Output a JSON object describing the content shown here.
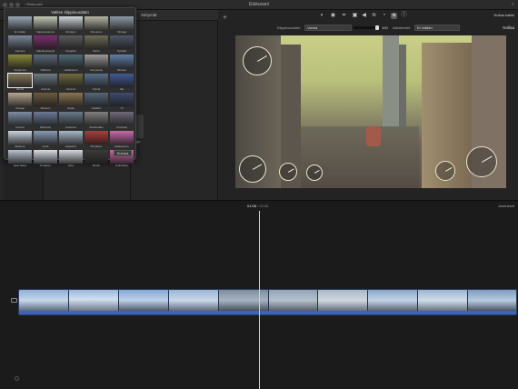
{
  "titlebar": {
    "title": "Elokuvani",
    "back_label": "Elokuvani",
    "share_label": ""
  },
  "left_panel": {
    "tab_label": "Siirtymät",
    "stub_label": "ge"
  },
  "toolbar": {
    "reset_all_label": "Nollaa kaikki",
    "icons": [
      "color-balance",
      "color-correction",
      "crop",
      "stabilization",
      "volume",
      "noise-reduction",
      "speed",
      "clip-filter",
      "info"
    ]
  },
  "options": {
    "clip_filter_label": "Klippisuodatin:",
    "clip_filter_value": "Vanha",
    "slider_value": "100",
    "audio_effects_label": "Ääniefektit:",
    "audio_effects_value": "Ei mitään",
    "reset_label": "Nollaa"
  },
  "timeline": {
    "current_time": "01:06",
    "total_time": "/ 02:56",
    "settings_label": "Asetukset"
  },
  "popup": {
    "title": "Valitse klippisuodatin",
    "cancel_label": "Kumoa",
    "filters": [
      {
        "name": "Ei mitään",
        "color": "#9aa7b5"
      },
      {
        "name": "Kaksoisvalotus",
        "color": "#c4c9b8"
      },
      {
        "name": "Röntgen",
        "color": "#d0d5d8"
      },
      {
        "name": "Romance",
        "color": "#b5b5a5"
      },
      {
        "name": "Vintage",
        "color": "#8f9aa5"
      },
      {
        "name": "Kamera",
        "color": "#7d8799"
      },
      {
        "name": "Kaleidoskooppi",
        "color": "#7a2e6e"
      },
      {
        "name": "Negatiivi",
        "color": "#5a5a5a"
      },
      {
        "name": "Retro",
        "color": "#6f6a55"
      },
      {
        "name": "Synkkä",
        "color": "#4d5566"
      },
      {
        "name": "Sarjakuva",
        "color": "#8a8a3a"
      },
      {
        "name": "Vilkkuva",
        "color": "#5a6a78"
      },
      {
        "name": "Haalistunut",
        "color": "#4f6a76"
      },
      {
        "name": "Kehystetty",
        "color": "#9a9a9a"
      },
      {
        "name": "Sininen",
        "color": "#5f7fa8"
      },
      {
        "name": "Vanha",
        "color": "#847a5a"
      },
      {
        "name": "Unelma",
        "color": "#6f7c82"
      },
      {
        "name": "Lämmin",
        "color": "#6f6a3f"
      },
      {
        "name": "Kylmä",
        "color": "#58708a"
      },
      {
        "name": "Ilta",
        "color": "#425a92"
      },
      {
        "name": "Vintage",
        "color": "#b8a890"
      },
      {
        "name": "Western",
        "color": "#6d5b3f"
      },
      {
        "name": "Sepia",
        "color": "#8c7552"
      },
      {
        "name": "Aavikko",
        "color": "#55667a"
      },
      {
        "name": "Yö",
        "color": "#3e4b6e"
      },
      {
        "name": "Kuvitus",
        "color": "#7e8ca2"
      },
      {
        "name": "Sävytetty",
        "color": "#6c7a96"
      },
      {
        "name": "Kuutamo",
        "color": "#6a7a8a"
      },
      {
        "name": "Mustavalko",
        "color": "#808080"
      },
      {
        "name": "Kontrasti",
        "color": "#6e6a78"
      },
      {
        "name": "Elokuva",
        "color": "#c9d3dd"
      },
      {
        "name": "Kesä",
        "color": "#8a9ab5"
      },
      {
        "name": "Heijastus",
        "color": "#aab8c8"
      },
      {
        "name": "Punainen",
        "color": "#b03a3a"
      },
      {
        "name": "Vaaleanpun.",
        "color": "#c86aa8"
      },
      {
        "name": "Heat Wave",
        "color": "#b9c2cf"
      },
      {
        "name": "Ylivalottu.",
        "color": "#d6dde4"
      },
      {
        "name": "Glow",
        "color": "#d2d7dc"
      },
      {
        "name": "Ruutu",
        "color": "#3a3a3a"
      },
      {
        "name": "Kolmisävy",
        "color": "#cc66a6"
      }
    ]
  }
}
